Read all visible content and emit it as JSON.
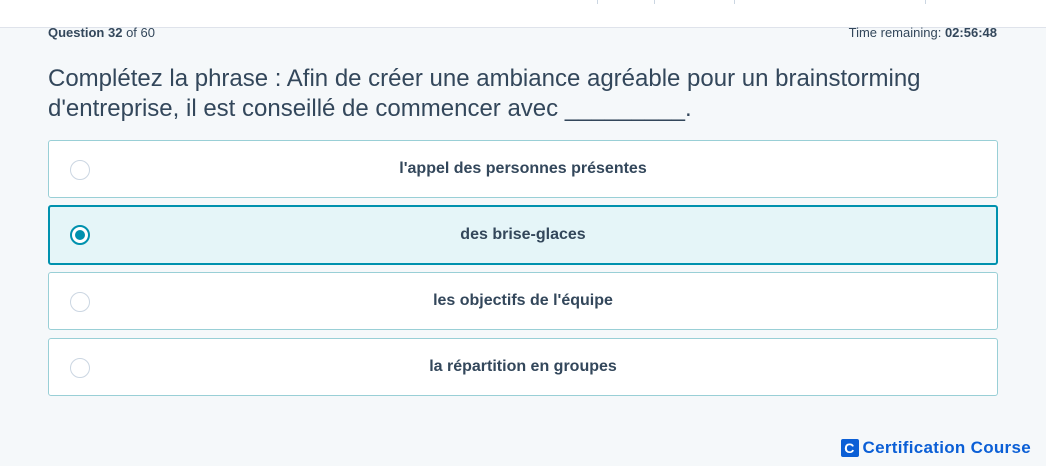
{
  "header": {
    "question_word": "Question",
    "question_number": "32",
    "of_text": "of 60",
    "time_label": "Time remaining:",
    "time_value": "02:56:48"
  },
  "question": {
    "text": "Complétez la phrase : Afin de créer une ambiance agréable pour un brainstorming d'entreprise, il est conseillé de commencer avec _________."
  },
  "options": [
    {
      "label": "l'appel des personnes présentes",
      "selected": false
    },
    {
      "label": "des brise-glaces",
      "selected": true
    },
    {
      "label": "les objectifs de l'équipe",
      "selected": false
    },
    {
      "label": "la répartition en groupes",
      "selected": false
    }
  ],
  "brand": {
    "logo_letter": "C",
    "name": "Certification Course"
  },
  "colors": {
    "accent": "#0091ae",
    "brand": "#0b5fd6",
    "text": "#33475b"
  }
}
